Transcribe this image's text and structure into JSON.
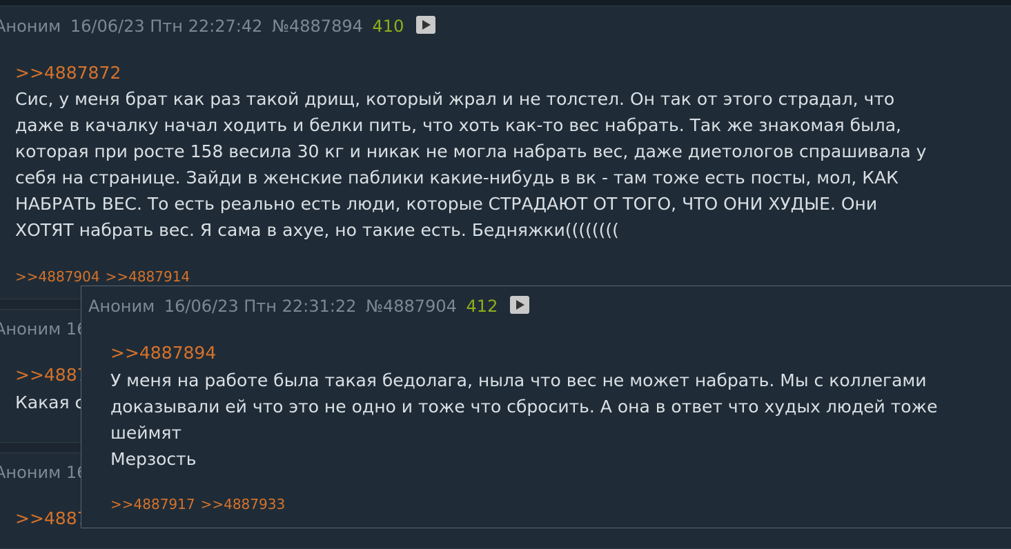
{
  "post1": {
    "author": "Аноним",
    "date": "16/06/23 Птн 22:27:42",
    "id": "№4887894",
    "count": "410",
    "reply_to": ">>4887872",
    "text": "Сис, у меня брат как раз такой дрищ, который жрал и не толстел. Он так от этого страдал, что\nдаже в качалку начал ходить и белки пить, что хоть как-то вес набрать. Так же знакомая была,\nкоторая при росте 158 весила 30 кг и никак не могла набрать вес, даже диетологов спрашивала у\nсебя на странице. Зайди в женские паблики какие-нибудь в вк - там тоже есть посты, мол, КАК\nНАБРАТЬ ВЕС. То есть реально есть люди, которые СТРАДАЮТ ОТ ТОГО, ЧТО ОНИ ХУДЫЕ. Они\nХОТЯТ набрать вес. Я сама в ахуе, но такие есть. Бедняжки((((((((",
    "replies": [
      ">>4887904",
      ">>4887914"
    ]
  },
  "post2": {
    "author_partial": "Аноним  16",
    "reply_partial": ">>4887",
    "text_partial": "Какая с"
  },
  "post3": {
    "author_partial": "Аноним  16",
    "reply_partial": ">>4887"
  },
  "popup": {
    "author": "Аноним",
    "date": "16/06/23 Птн 22:31:22",
    "id": "№4887904",
    "count": "412",
    "reply_to": ">>4887894",
    "text": "У меня на работе была такая бедолага, ныла что вес не может набрать. Мы с коллегами\nдоказывали ей что это не одно и тоже что сбросить. А она в ответ что худых людей тоже\nшеймят\nМерзость",
    "replies": [
      ">>4887917",
      ">>4887933"
    ]
  }
}
